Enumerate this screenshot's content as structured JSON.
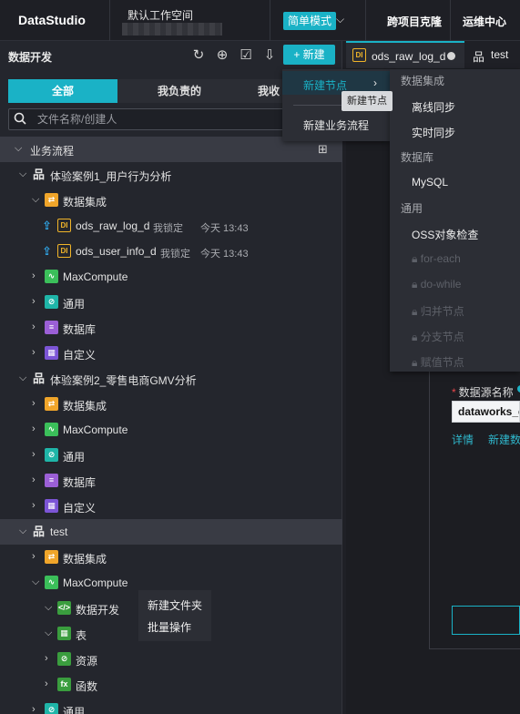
{
  "app": {
    "brand": "DataStudio",
    "workspace": "默认工作空间"
  },
  "topbar": {
    "simple_mode": "简单模式",
    "cross_clone": "跨项目克隆",
    "ops_center": "运维中心"
  },
  "panel": {
    "title": "数据开发",
    "new_button": "+ 新建",
    "tabs": [
      "全部",
      "我负责的",
      "我收"
    ],
    "search_placeholder": "文件名称/创建人"
  },
  "tree": {
    "root": "业务流程",
    "flow1": "体验案例1_用户行为分析",
    "integration": "数据集成",
    "node1": {
      "name": "ods_raw_log_d",
      "lock": "我锁定",
      "time": "今天 13:43"
    },
    "node2": {
      "name": "ods_user_info_d",
      "lock": "我锁定",
      "time": "今天 13:43"
    },
    "maxcompute": "MaxCompute",
    "general": "通用",
    "database": "数据库",
    "custom": "自定义",
    "flow2": "体验案例2_零售电商GMV分析",
    "flow3": "test",
    "dev": "数据开发",
    "table": "表",
    "resource": "资源",
    "function": "函数"
  },
  "context_menu": {
    "new_folder": "新建文件夹",
    "batch_ops": "批量操作"
  },
  "editor_tabs": {
    "tab1": "ods_raw_log_d",
    "tab2": "test"
  },
  "new_menu": {
    "new_node": "新建节点",
    "new_flow": "新建业务流程",
    "tooltip": "新建节点"
  },
  "sub_menu": {
    "group_integration": "数据集成",
    "offline_sync": "离线同步",
    "realtime_sync": "实时同步",
    "group_database": "数据库",
    "mysql": "MySQL",
    "group_general": "通用",
    "oss_check": "OSS对象检查",
    "disabled": [
      "for-each",
      "do-while",
      "归并节点",
      "分支节点",
      "赋值节点"
    ]
  },
  "form": {
    "ds_label": "数据源名称",
    "ds_value": "dataworks_de",
    "detail_link": "详情",
    "new_ds_link": "新建数"
  },
  "colors": {
    "accent": "#1ab2c6",
    "background": "#1f2026",
    "panel": "#24262d"
  }
}
